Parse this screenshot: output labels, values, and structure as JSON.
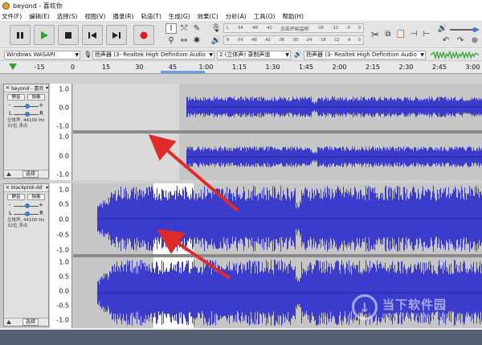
{
  "window": {
    "title": "beyond - 喜欢你"
  },
  "menu": {
    "items": [
      "文件(F)",
      "编辑(E)",
      "选择(S)",
      "视图(V)",
      "播录(R)",
      "轨道(T)",
      "生成(G)",
      "效果(C)",
      "分析(A)",
      "工具(O)",
      "帮助(H)"
    ]
  },
  "toolbar": {
    "transport": [
      "pause-icon",
      "play-icon",
      "stop-icon",
      "skip-start-icon",
      "skip-end-icon",
      "record-icon"
    ],
    "record_meter_hint": "点击开始监听",
    "meter_ticks_top": [
      "-54",
      "-48",
      "-42",
      "-18",
      "-12",
      "-6",
      "0"
    ],
    "meter_ticks_bottom": [
      "-54",
      "-48",
      "-42",
      "-36",
      "-30",
      "-24",
      "-18",
      "-12",
      "-6",
      "0"
    ],
    "meter_lr": [
      "L",
      "R"
    ]
  },
  "devices": {
    "host": "Windows WASAPI",
    "recording_device": "扬声器 (3- Realtek High Definition Audio",
    "channels": "2 (立体声) 录制声道",
    "playback_device": "扬声器 (3- Realtek High Definition Audio"
  },
  "timeline": {
    "ticks": [
      "-15",
      "0",
      "15",
      "30",
      "45",
      "1:00",
      "1:15",
      "1:30",
      "1:45",
      "2:00",
      "2:15",
      "2:30",
      "2:45",
      "3:00"
    ]
  },
  "tracks": [
    {
      "name": "beyond - 喜欢",
      "mute_label": "静音",
      "solo_label": "独奏",
      "gain_minus": "-",
      "gain_plus": "+",
      "pan_left": "L",
      "pan_right": "R",
      "info_line1": "立体声, 44100 Hz",
      "info_line2": "32位 浮点",
      "select_label": "选择",
      "scale_labels": [
        "1.0",
        "0.0",
        "-1.0",
        "1.0",
        "0.0",
        "-1.0"
      ]
    },
    {
      "name": "blackpink-dd",
      "mute_label": "静音",
      "solo_label": "独奏",
      "gain_minus": "-",
      "gain_plus": "+",
      "pan_left": "L",
      "pan_right": "R",
      "info_line1": "立体声, 44100 Hz",
      "info_line2": "32位 浮点",
      "select_label": "选择",
      "scale_labels": [
        "1.0",
        "0.5",
        "0.0",
        "-0.5",
        "-1.0",
        "1.0",
        "0.5",
        "0.0",
        "-0.5",
        "-1.0"
      ]
    }
  ],
  "watermark": {
    "text": "当下软件园",
    "subtext": "WWW.DOWNXIA.COM"
  },
  "colors": {
    "waveform": "#3c3ccc",
    "waveform_peak": "#2424a8",
    "wave_background": "#c6c6c6",
    "selection": "#ffffff",
    "annotation_arrow": "#e02a2a"
  }
}
